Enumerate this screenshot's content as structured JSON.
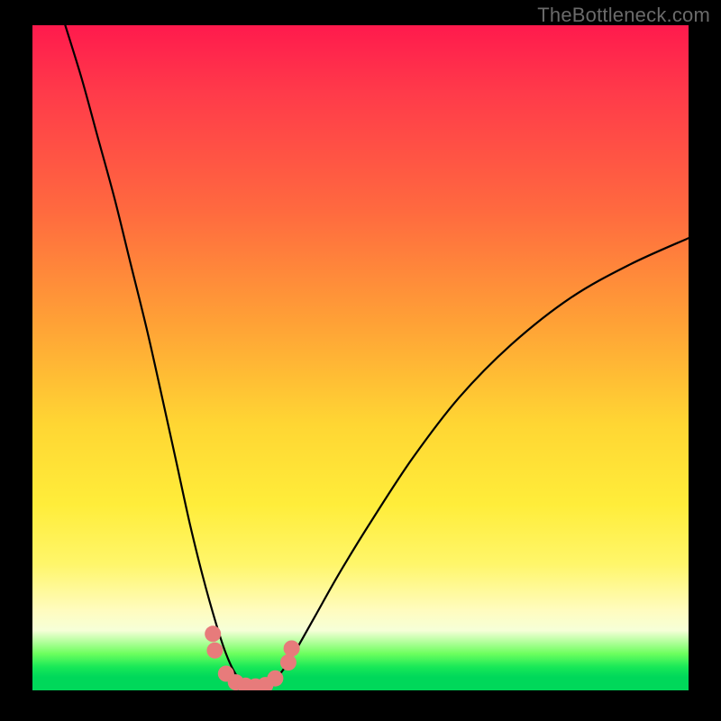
{
  "watermark": "TheBottleneck.com",
  "chart_data": {
    "type": "line",
    "title": "",
    "xlabel": "",
    "ylabel": "",
    "xlim": [
      0,
      1
    ],
    "ylim": [
      0,
      1
    ],
    "series": [
      {
        "name": "curve",
        "x": [
          0.05,
          0.075,
          0.1,
          0.125,
          0.15,
          0.175,
          0.2,
          0.22,
          0.24,
          0.26,
          0.28,
          0.295,
          0.31,
          0.325,
          0.335,
          0.35,
          0.365,
          0.38,
          0.4,
          0.43,
          0.47,
          0.52,
          0.58,
          0.65,
          0.73,
          0.82,
          0.91,
          1.0
        ],
        "y": [
          1.0,
          0.92,
          0.83,
          0.74,
          0.64,
          0.54,
          0.43,
          0.34,
          0.25,
          0.17,
          0.1,
          0.055,
          0.024,
          0.008,
          0.003,
          0.005,
          0.013,
          0.028,
          0.058,
          0.11,
          0.18,
          0.26,
          0.35,
          0.44,
          0.52,
          0.59,
          0.64,
          0.68
        ]
      }
    ],
    "markers": {
      "name": "bottom-cluster",
      "color": "#e77b7b",
      "points": [
        {
          "x": 0.275,
          "y": 0.085
        },
        {
          "x": 0.278,
          "y": 0.06
        },
        {
          "x": 0.295,
          "y": 0.025
        },
        {
          "x": 0.31,
          "y": 0.012
        },
        {
          "x": 0.325,
          "y": 0.007
        },
        {
          "x": 0.34,
          "y": 0.006
        },
        {
          "x": 0.355,
          "y": 0.008
        },
        {
          "x": 0.37,
          "y": 0.018
        },
        {
          "x": 0.39,
          "y": 0.042
        },
        {
          "x": 0.395,
          "y": 0.063
        }
      ]
    },
    "background_gradient": {
      "top": "#ff1a4d",
      "mid1": "#ffa236",
      "mid2": "#ffed3a",
      "pale": "#fffcbf",
      "green": "#00d85a"
    }
  }
}
